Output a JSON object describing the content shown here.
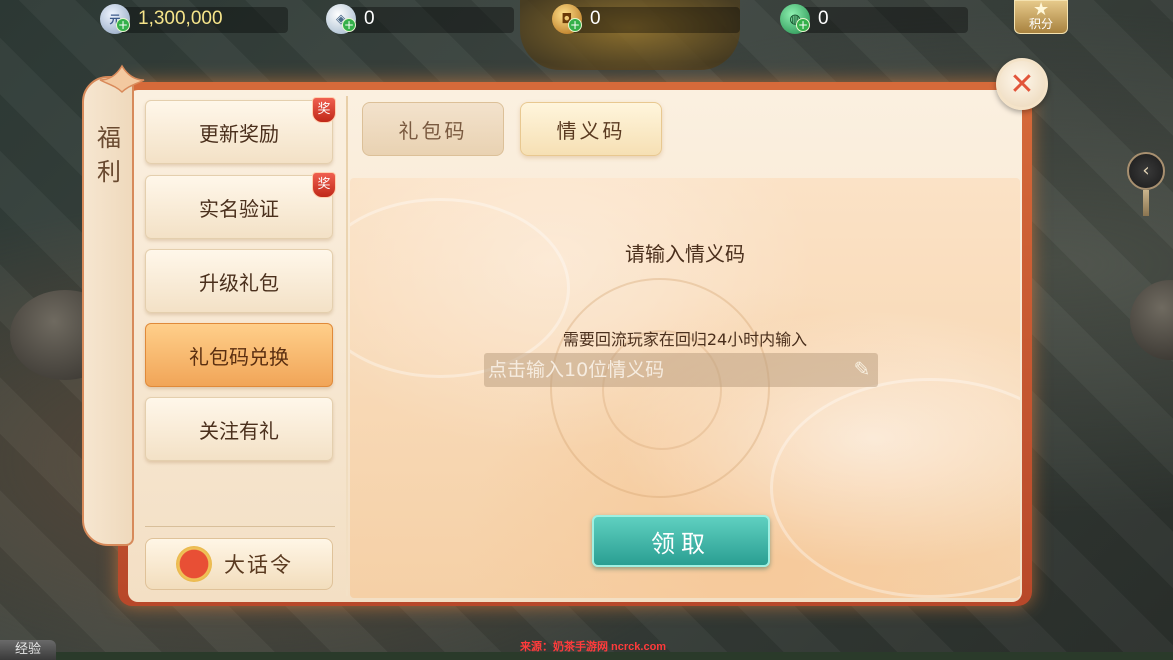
{
  "currencies": [
    {
      "icon": "silver-ingot-icon",
      "glyph": "元",
      "value": "1,300,000"
    },
    {
      "icon": "silver-coin-icon",
      "glyph": "◈",
      "value": "0"
    },
    {
      "icon": "copper-coin-icon",
      "glyph": "◘",
      "value": "0"
    },
    {
      "icon": "jade-icon",
      "glyph": "◍",
      "value": "0"
    }
  ],
  "points_label": "积分",
  "panel_title": [
    "福",
    "利"
  ],
  "sidebar": {
    "items": [
      {
        "label": "更新奖励",
        "badge": "奖"
      },
      {
        "label": "实名验证",
        "badge": "奖"
      },
      {
        "label": "升级礼包",
        "badge": ""
      },
      {
        "label": "礼包码兑换",
        "badge": ""
      },
      {
        "label": "关注有礼",
        "badge": ""
      }
    ],
    "selected": "礼包码兑换",
    "bottom_label": "大话令"
  },
  "tabs": [
    {
      "label": "礼包码"
    },
    {
      "label": "情义码"
    }
  ],
  "active_tab": "情义码",
  "form": {
    "prompt": "请输入情义码",
    "hint": "需要回流玩家在回归24小时内输入",
    "placeholder": "点击输入10位情义码",
    "value": ""
  },
  "claim_label": "领取",
  "close_glyph": "✕",
  "exp_label": "经验",
  "source_text": "来源：奶茶手游网 ncrck.com",
  "colors": {
    "panel_border": "#c8532e",
    "claim_button": "#3cb3a5",
    "active_sidebar": "#f5b466",
    "badge_red": "#d8372a"
  }
}
